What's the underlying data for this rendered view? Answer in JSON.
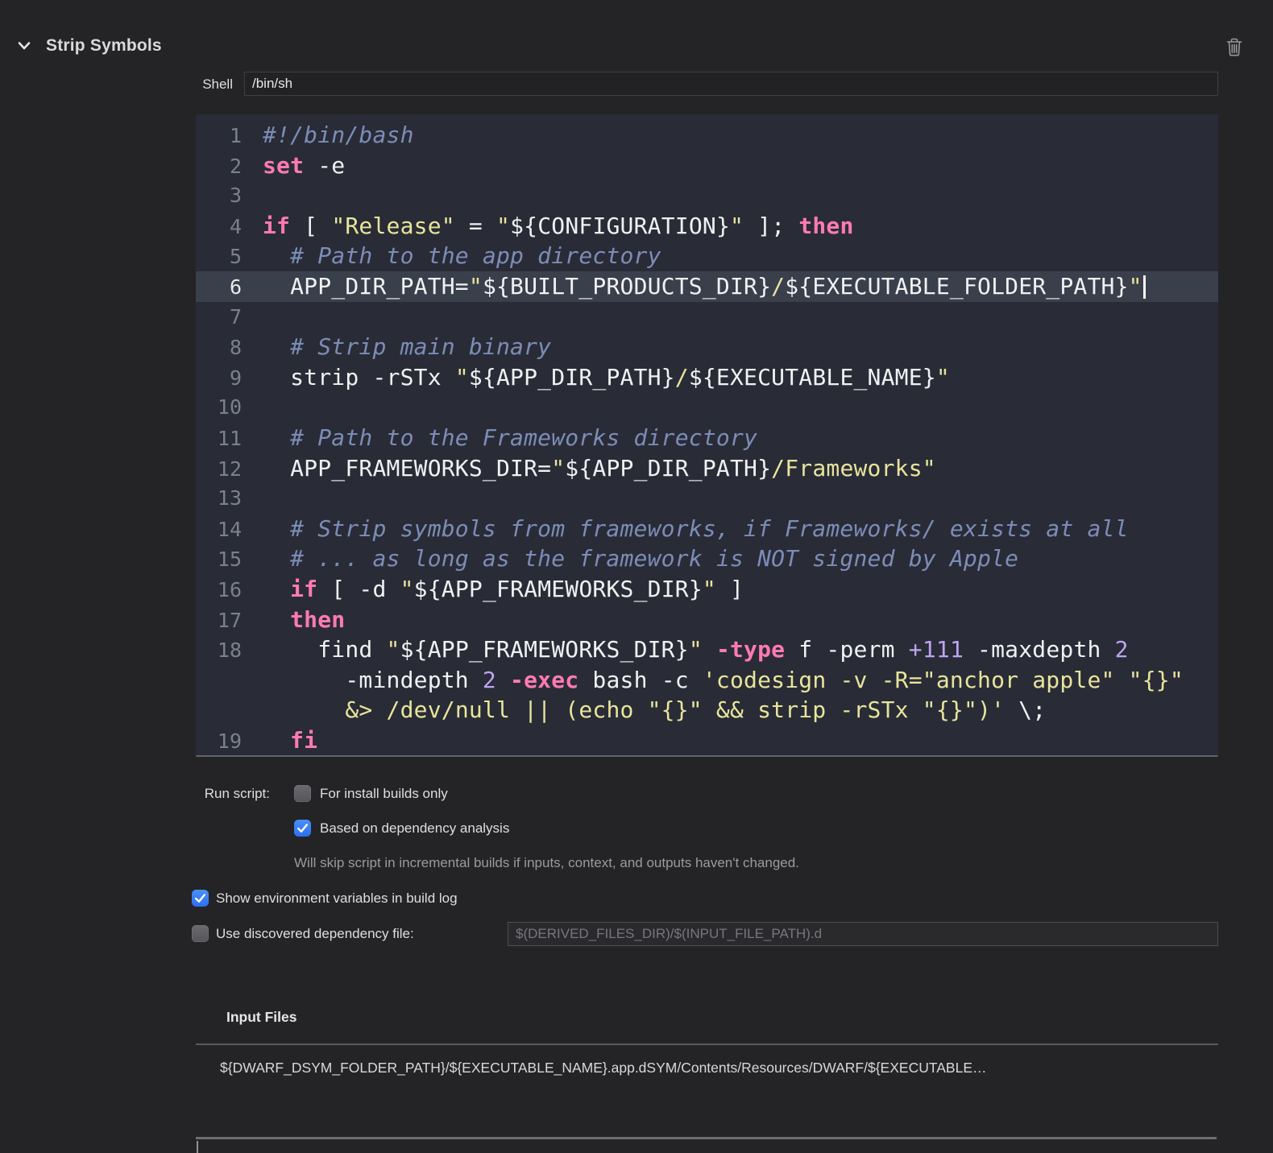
{
  "header": {
    "title": "Strip Symbols"
  },
  "icons": {
    "collapse": "chevron-down",
    "delete": "trash"
  },
  "shell": {
    "label": "Shell",
    "value": "/bin/sh"
  },
  "colors": {
    "accent_blue": "#3478F6",
    "editor_background": "#292C36",
    "current_line": "#3A3F4C",
    "keyword": "#FF7AB2",
    "string": "#E9E49C",
    "comment": "#7D8CB8",
    "number": "#BFA3F3"
  },
  "editor": {
    "lines": [
      {
        "n": "1",
        "seg": [
          [
            "c",
            "#!/bin/bash"
          ]
        ]
      },
      {
        "n": "2",
        "seg": [
          [
            "k",
            "set"
          ],
          [
            "p",
            " -e"
          ]
        ]
      },
      {
        "n": "3",
        "seg": []
      },
      {
        "n": "4",
        "seg": [
          [
            "k",
            "if"
          ],
          [
            "p",
            " [ "
          ],
          [
            "s",
            "\"Release\""
          ],
          [
            "p",
            " = "
          ],
          [
            "s",
            "\""
          ],
          [
            "p",
            "${CONFIGURATION}"
          ],
          [
            "s",
            "\""
          ],
          [
            "p",
            " ]; "
          ],
          [
            "k",
            "then"
          ]
        ]
      },
      {
        "n": "5",
        "seg": [
          [
            "c",
            "  # Path to the app directory"
          ]
        ]
      },
      {
        "n": "6",
        "hl": true,
        "cursor": true,
        "seg": [
          [
            "p",
            "  APP_DIR_PATH="
          ],
          [
            "s",
            "\""
          ],
          [
            "p",
            "${BUILT_PRODUCTS_DIR}"
          ],
          [
            "s",
            "/"
          ],
          [
            "p",
            "${EXECUTABLE_FOLDER_PATH}"
          ],
          [
            "s",
            "\""
          ]
        ]
      },
      {
        "n": "7",
        "seg": []
      },
      {
        "n": "8",
        "seg": [
          [
            "c",
            "  # Strip main binary"
          ]
        ]
      },
      {
        "n": "9",
        "seg": [
          [
            "p",
            "  strip -rSTx "
          ],
          [
            "s",
            "\""
          ],
          [
            "p",
            "${APP_DIR_PATH}"
          ],
          [
            "s",
            "/"
          ],
          [
            "p",
            "${EXECUTABLE_NAME}"
          ],
          [
            "s",
            "\""
          ]
        ]
      },
      {
        "n": "10",
        "seg": []
      },
      {
        "n": "11",
        "seg": [
          [
            "c",
            "  # Path to the Frameworks directory"
          ]
        ]
      },
      {
        "n": "12",
        "seg": [
          [
            "p",
            "  APP_FRAMEWORKS_DIR="
          ],
          [
            "s",
            "\""
          ],
          [
            "p",
            "${APP_DIR_PATH}"
          ],
          [
            "s",
            "/Frameworks\""
          ]
        ]
      },
      {
        "n": "13",
        "seg": []
      },
      {
        "n": "14",
        "seg": [
          [
            "c",
            "  # Strip symbols from frameworks, if Frameworks/ exists at all"
          ]
        ]
      },
      {
        "n": "15",
        "seg": [
          [
            "c",
            "  # ... as long as the framework is NOT signed by Apple"
          ]
        ]
      },
      {
        "n": "16",
        "seg": [
          [
            "p",
            "  "
          ],
          [
            "k",
            "if"
          ],
          [
            "p",
            " [ -d "
          ],
          [
            "s",
            "\""
          ],
          [
            "p",
            "${APP_FRAMEWORKS_DIR}"
          ],
          [
            "s",
            "\""
          ],
          [
            "p",
            " ]"
          ]
        ]
      },
      {
        "n": "17",
        "seg": [
          [
            "p",
            "  "
          ],
          [
            "k",
            "then"
          ]
        ]
      },
      {
        "n": "18",
        "seg": [
          [
            "p",
            "    find "
          ],
          [
            "s",
            "\""
          ],
          [
            "p",
            "${APP_FRAMEWORKS_DIR}"
          ],
          [
            "s",
            "\""
          ],
          [
            "p",
            " "
          ],
          [
            "k",
            "-type"
          ],
          [
            "p",
            " f -perm "
          ],
          [
            "n",
            "+111"
          ],
          [
            "p",
            " -maxdepth "
          ],
          [
            "n",
            "2"
          ]
        ]
      },
      {
        "n": "",
        "seg": [
          [
            "p",
            "      -mindepth "
          ],
          [
            "n",
            "2"
          ],
          [
            "p",
            " "
          ],
          [
            "k",
            "-exec"
          ],
          [
            "p",
            " bash -c "
          ],
          [
            "s",
            "'codesign -v -R=\"anchor apple\" \"{}\""
          ]
        ]
      },
      {
        "n": "",
        "seg": [
          [
            "p",
            "      "
          ],
          [
            "s",
            "&> /dev/null || (echo \"{}\" && strip -rSTx \"{}\")'"
          ],
          [
            "p",
            " \\;"
          ]
        ]
      },
      {
        "n": "19",
        "seg": [
          [
            "p",
            "  "
          ],
          [
            "k",
            "fi"
          ]
        ]
      }
    ]
  },
  "options": {
    "run_script_label": "Run script:",
    "install_only": {
      "label": "For install builds only",
      "checked": false
    },
    "dependency_analysis": {
      "label": "Based on dependency analysis",
      "checked": true
    },
    "dependency_note": "Will skip script in incremental builds if inputs, context, and outputs haven't changed.",
    "show_env": {
      "label": "Show environment variables in build log",
      "checked": true
    },
    "discovered_dep": {
      "label": "Use discovered dependency file:",
      "checked": false,
      "placeholder": "$(DERIVED_FILES_DIR)/$(INPUT_FILE_PATH).d"
    }
  },
  "input_files": {
    "title": "Input Files",
    "rows": [
      "${DWARF_DSYM_FOLDER_PATH}/${EXECUTABLE_NAME}.app.dSYM/Contents/Resources/DWARF/${EXECUTABLE…"
    ]
  }
}
